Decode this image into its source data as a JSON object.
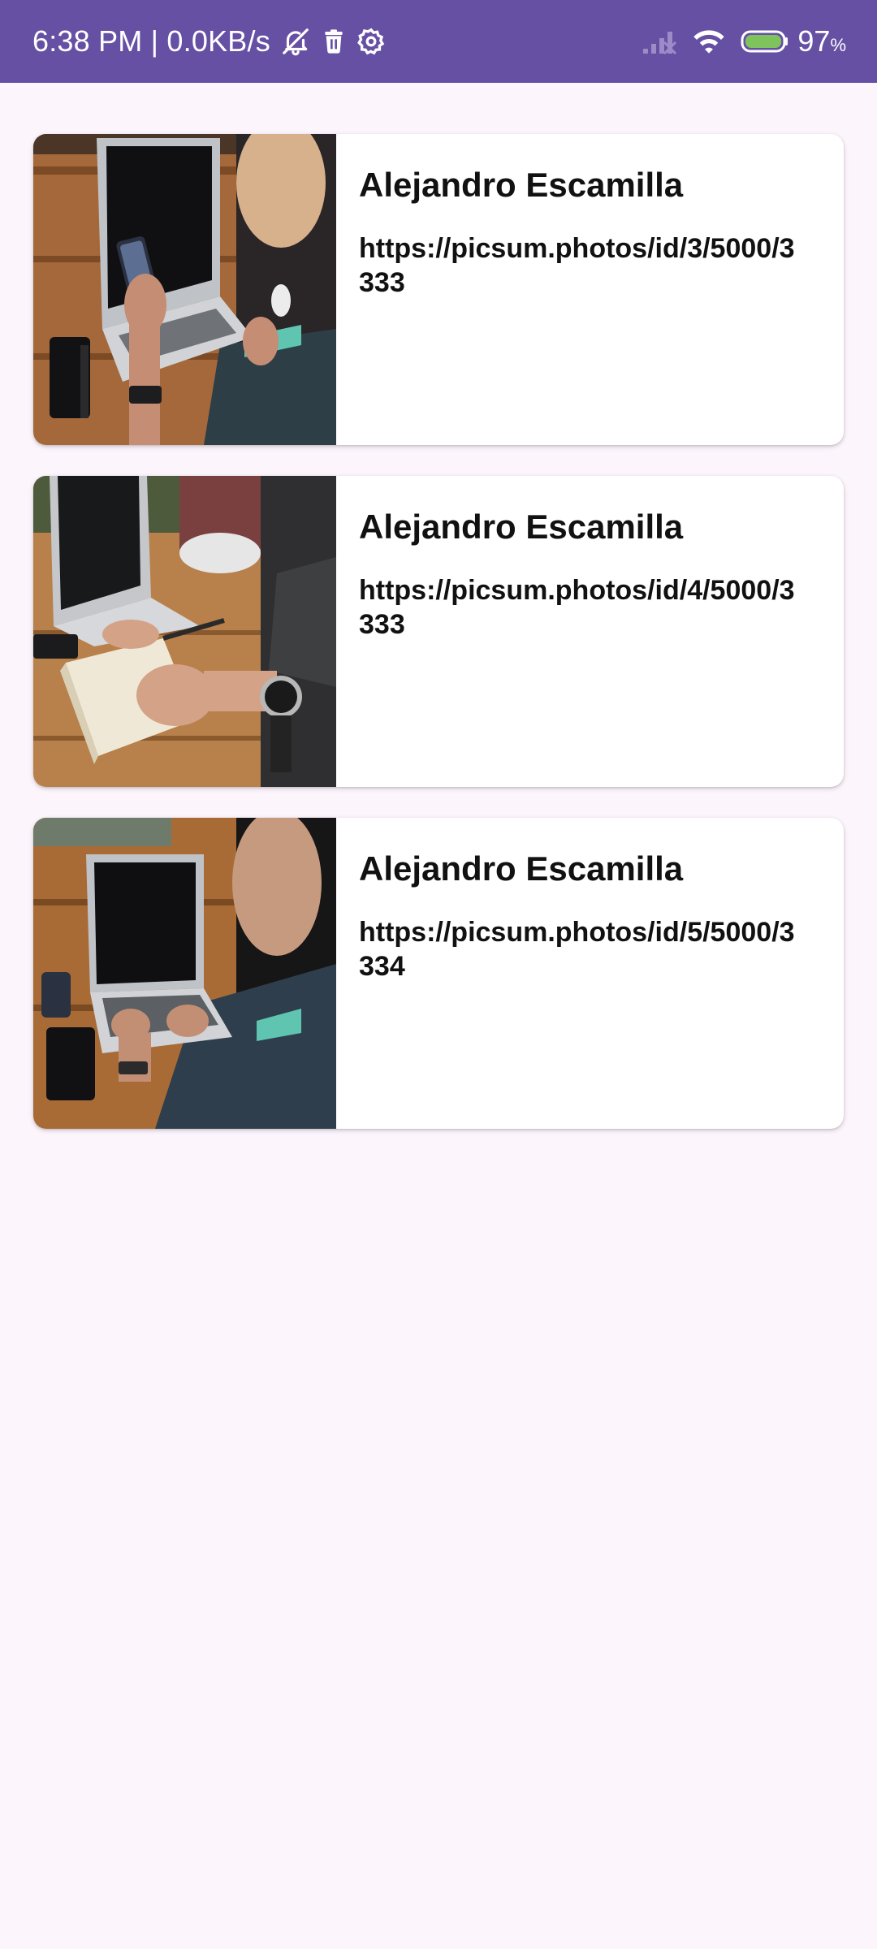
{
  "status_bar": {
    "time_speed": "6:38 PM | 0.0KB/s",
    "battery_value": "97",
    "battery_unit": "%",
    "background": "#6650a4",
    "icons": [
      "bell-off-icon",
      "trash-icon",
      "settings-icon",
      "signal-icon",
      "wifi-icon",
      "battery-icon"
    ]
  },
  "cards": [
    {
      "author": "Alejandro Escamilla",
      "url": "https://picsum.photos/id/3/5000/3333",
      "image": "laptop-phone-photo"
    },
    {
      "author": "Alejandro Escamilla",
      "url": "https://picsum.photos/id/4/5000/3333",
      "image": "writing-notebook-photo"
    },
    {
      "author": "Alejandro Escamilla",
      "url": "https://picsum.photos/id/5/5000/3334",
      "image": "laptop-typing-photo"
    }
  ],
  "colors": {
    "background": "#fcf5fc",
    "card": "#ffffff",
    "text": "#111111"
  }
}
